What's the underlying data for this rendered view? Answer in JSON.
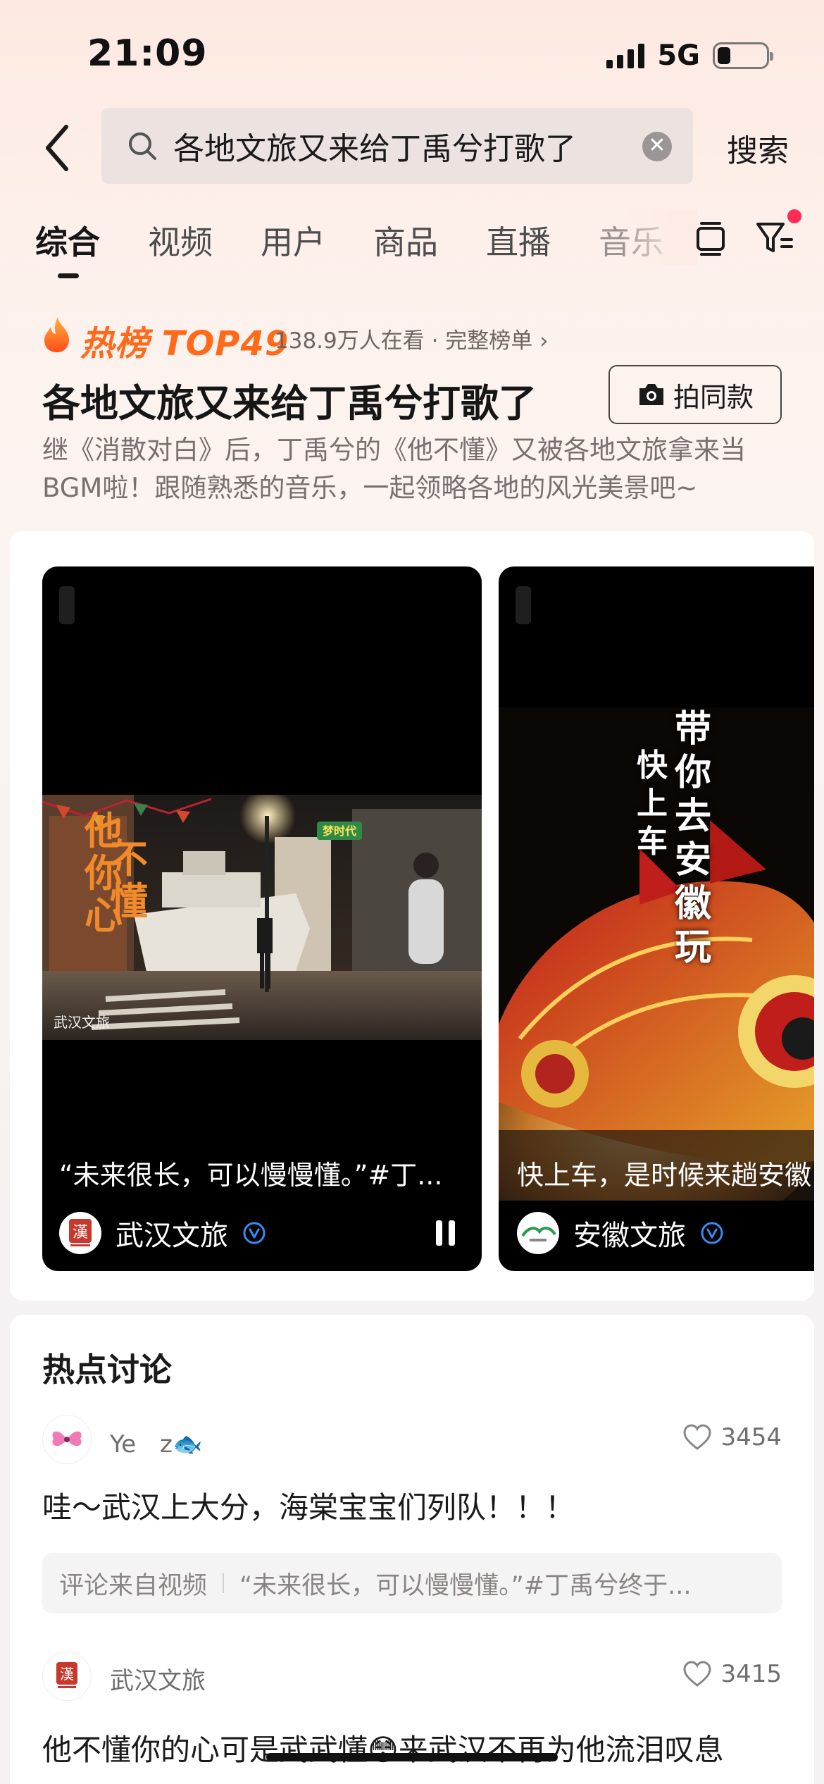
{
  "status_bar": {
    "time": "21:09",
    "network": "5G"
  },
  "search": {
    "query": "各地文旅又来给丁禹兮打歌了",
    "button_label": "搜索"
  },
  "tabs": [
    {
      "label": "综合",
      "active": true
    },
    {
      "label": "视频"
    },
    {
      "label": "用户"
    },
    {
      "label": "商品"
    },
    {
      "label": "直播"
    },
    {
      "label": "音乐"
    }
  ],
  "hot_topic": {
    "badge": "热榜 TOP49",
    "meta": "138.9万人在看 · 完整榜单 ›",
    "title": "各地文旅又来给丁禹兮打歌了",
    "shoot_button": "拍同款",
    "description": "继《消散对白》后，丁禹兮的《他不懂》又被各地文旅拿来当BGM啦！跟随熟悉的音乐，一起领略各地的风光美景吧~"
  },
  "videos": [
    {
      "caption": "“未来很长，可以慢慢懂。”#丁...",
      "author": "武汉文旅",
      "overlay_text": "他不懂你的心",
      "watermark": "武汉文旅",
      "sign": "梦时代",
      "playing": true
    },
    {
      "caption": "快上车，是时候来趟安徽",
      "author": "安徽文旅",
      "overlay_main": "带你去安徽玩",
      "overlay_side": "快上车"
    }
  ],
  "discussion": {
    "title": "热点讨论",
    "comments": [
      {
        "user": "Ye　z🐟",
        "likes": "3454",
        "text": "哇～武汉上大分，海棠宝宝们列队！！！",
        "source_label": "评论来自视频",
        "source_text": "“未来很长，可以慢慢懂。”#丁禹兮终于..."
      },
      {
        "user": "武汉文旅",
        "likes": "3415",
        "text": "他不懂你的心可是武武懂😳来武汉不再为他流泪叹息"
      }
    ]
  },
  "colors": {
    "accent": "#fe2c55",
    "hot_orange": "#ff6a1a",
    "verified_blue": "#3b8af2"
  }
}
